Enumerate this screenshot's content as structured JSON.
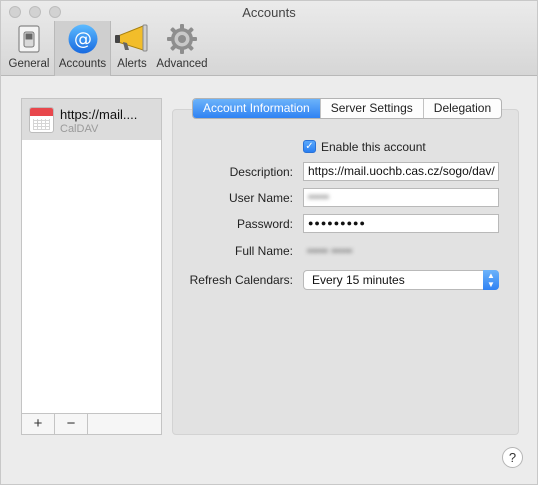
{
  "window": {
    "title": "Accounts"
  },
  "toolbar": {
    "items": [
      {
        "label": "General",
        "icon": "switch-icon"
      },
      {
        "label": "Accounts",
        "icon": "at-sign-icon",
        "selected": true
      },
      {
        "label": "Alerts",
        "icon": "megaphone-icon"
      },
      {
        "label": "Advanced",
        "icon": "gear-icon"
      }
    ]
  },
  "accounts_list": {
    "items": [
      {
        "name": "https://mail....",
        "type": "CalDAV"
      }
    ],
    "add_label": "+",
    "remove_label": "−"
  },
  "tabs": [
    {
      "label": "Account Information",
      "active": true
    },
    {
      "label": "Server Settings"
    },
    {
      "label": "Delegation"
    }
  ],
  "form": {
    "enable_label": "Enable this account",
    "enabled": true,
    "description_label": "Description:",
    "description_value": "https://mail.uochb.cas.cz/sogo/dav/",
    "username_label": "User Name:",
    "username_value": "•••••",
    "password_label": "Password:",
    "password_value": "●●●●●●●●●",
    "fullname_label": "Full Name:",
    "fullname_value": "••••• •••••",
    "refresh_label": "Refresh Calendars:",
    "refresh_value": "Every 15 minutes"
  },
  "help_label": "?",
  "colors": {
    "accent": "#2f82f3",
    "calendar_red": "#e8474c"
  }
}
